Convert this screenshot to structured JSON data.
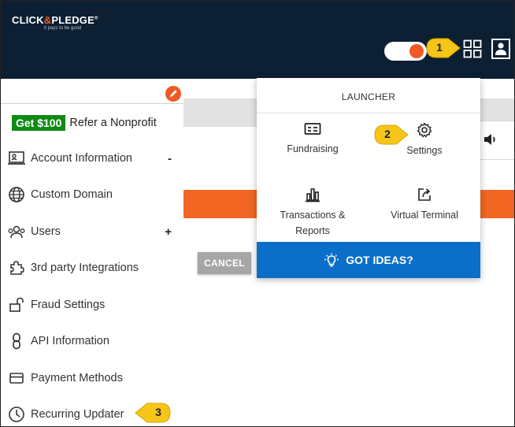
{
  "header": {
    "logo_left": "CLICK",
    "logo_amp": "&",
    "logo_right": "PLEDGE",
    "logo_mark": "®",
    "tagline": "it pays to be good",
    "toggle_state": "on",
    "icons": [
      "apps-grid-icon",
      "user-profile-icon"
    ]
  },
  "callouts": {
    "one": "1",
    "two": "2",
    "three": "3"
  },
  "sidebar": {
    "refer_badge": "Get $100",
    "refer_text": "Refer a Nonprofit",
    "items": [
      {
        "label": "Account Information",
        "sign": "-",
        "icon": "account-card-icon"
      },
      {
        "label": "Custom Domain",
        "sign": "",
        "icon": "globe-icon"
      },
      {
        "label": "Users",
        "sign": "+",
        "icon": "users-icon"
      },
      {
        "label": "3rd party Integrations",
        "sign": "",
        "icon": "puzzle-icon"
      },
      {
        "label": "Fraud Settings",
        "sign": "",
        "icon": "lock-icon"
      },
      {
        "label": "API Information",
        "sign": "",
        "icon": "link-icon"
      },
      {
        "label": "Payment Methods",
        "sign": "",
        "icon": "credit-card-icon"
      },
      {
        "label": "Recurring Updater",
        "sign": "",
        "icon": "clock-icon"
      }
    ]
  },
  "main": {
    "cancel_label": "CANCEL"
  },
  "launcher": {
    "title": "LAUNCHER",
    "tiles": {
      "fundraising": "Fundraising",
      "settings": "Settings",
      "transactions_line1": "Transactions &",
      "transactions_line2": "Reports",
      "virtual_terminal": "Virtual Terminal"
    },
    "ideas_label": "GOT IDEAS?"
  },
  "colors": {
    "header_bg": "#0d1f33",
    "accent_orange": "#f26522",
    "ideas_blue": "#0b6fc9",
    "badge_green": "#108a16",
    "callout_yellow": "#f5c518"
  }
}
